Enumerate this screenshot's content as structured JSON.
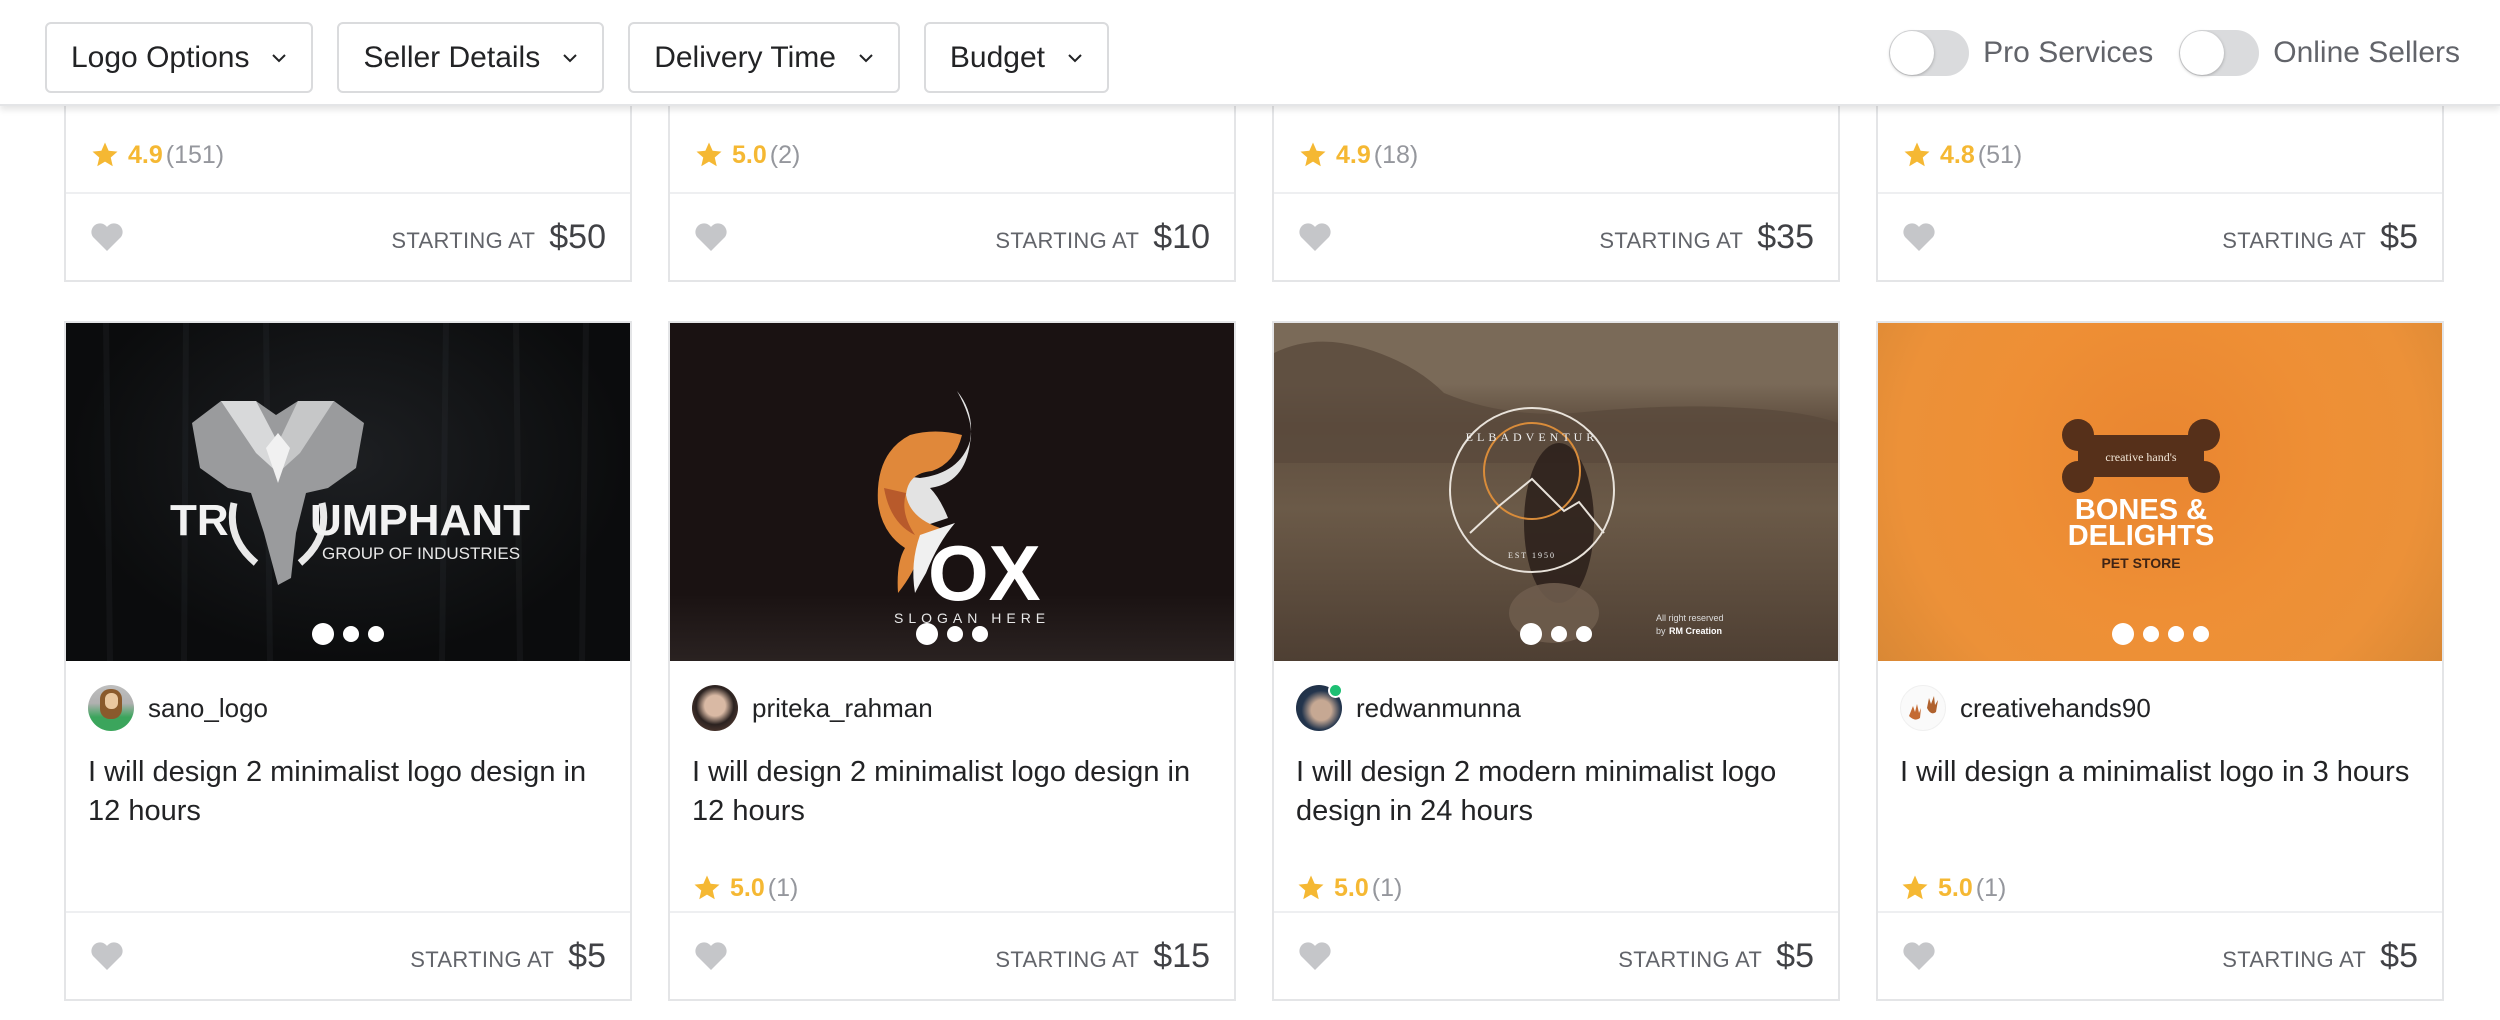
{
  "filters": [
    {
      "label": "Logo Options"
    },
    {
      "label": "Seller Details"
    },
    {
      "label": "Delivery Time"
    },
    {
      "label": "Budget"
    }
  ],
  "toggles": [
    {
      "label": "Pro Services",
      "on": false
    },
    {
      "label": "Online Sellers",
      "on": false
    }
  ],
  "colors": {
    "star": "#f5b833",
    "online": "#1dbf73",
    "heart": "#c5c6c9"
  },
  "starting_label": "STARTING AT",
  "top_cards": [
    {
      "rating": "4.9",
      "count": "(151)",
      "price": "$50"
    },
    {
      "rating": "5.0",
      "count": "(2)",
      "price": "$10"
    },
    {
      "rating": "4.9",
      "count": "(18)",
      "price": "$35"
    },
    {
      "rating": "4.8",
      "count": "(51)",
      "price": "$5"
    }
  ],
  "gigs": [
    {
      "seller": "sano_logo",
      "title": "I will design 2 minimalist logo design in 12 hours",
      "rating": null,
      "count": null,
      "price": "$5",
      "slides": 3,
      "active_slide": 1,
      "image": {
        "title": "TR  UMPHANT",
        "subtitle": "GROUP OF INDUSTRIES"
      }
    },
    {
      "seller": "priteka_rahman",
      "title": "I will design 2 minimalist logo design in 12 hours",
      "rating": "5.0",
      "count": "(1)",
      "price": "$15",
      "slides": 3,
      "active_slide": 1,
      "image": {
        "title": "OX",
        "subtitle": "SLOGAN HERE"
      }
    },
    {
      "seller": "redwanmunna",
      "online": true,
      "title": "I will design 2 modern minimalist logo design in 24 hours",
      "rating": "5.0",
      "count": "(1)",
      "price": "$5",
      "slides": 3,
      "active_slide": 1,
      "image": {
        "title": "ELBADVENTUR",
        "subtitle": "EST 1950",
        "credit_line1": "All right reserved",
        "credit_prefix": "by",
        "credit_name": "RM Creation"
      }
    },
    {
      "seller": "creativehands90",
      "title": "I will design a minimalist logo in 3 hours",
      "rating": "5.0",
      "count": "(1)",
      "price": "$5",
      "slides": 4,
      "active_slide": 1,
      "image": {
        "tag": "creative hand's",
        "title_line1": "BONES &",
        "title_line2": "DELIGHTS",
        "subtitle": "PET STORE"
      }
    }
  ]
}
